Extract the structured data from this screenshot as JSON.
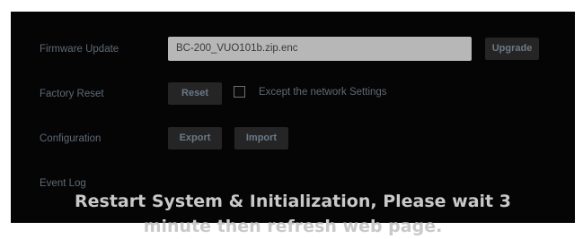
{
  "firmware_update": {
    "label": "Firmware Update",
    "file_value": "BC-200_VUO101b.zip.enc",
    "upgrade_button": "Upgrade"
  },
  "factory_reset": {
    "label": "Factory Reset",
    "reset_button": "Reset",
    "except_network_checked": false,
    "except_network_label": "Except the network Settings"
  },
  "configuration": {
    "label": "Configuration",
    "export_button": "Export",
    "import_button": "Import"
  },
  "event_log": {
    "label": "Event Log"
  },
  "overlay_message": {
    "line1": "Restart System & Initialization, Please wait 3",
    "line2": "minute then refresh web page."
  }
}
